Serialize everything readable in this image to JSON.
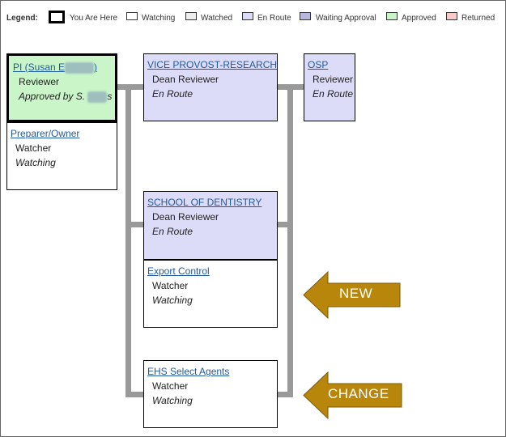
{
  "legend": {
    "title": "Legend:",
    "items": [
      {
        "label": "You Are Here",
        "color": "#ffffff"
      },
      {
        "label": "Watching",
        "color": "#ffffff"
      },
      {
        "label": "Watched",
        "color": "#eeeeee"
      },
      {
        "label": "En Route",
        "color": "#dcdcf8"
      },
      {
        "label": "Waiting Approval",
        "color": "#b8b8de"
      },
      {
        "label": "Approved",
        "color": "#c9f5c9"
      },
      {
        "label": "Returned",
        "color": "#f8caca"
      }
    ]
  },
  "nodes": {
    "pi": {
      "title_prefix": "PI (Susan E",
      "title_suffix": ")",
      "role": "Reviewer",
      "status_prefix": "Approved by S.",
      "status_suffix": "s"
    },
    "preparer": {
      "title": "Preparer/Owner",
      "role": "Watcher",
      "status": "Watching"
    },
    "vice_provost": {
      "title": "VICE PROVOST-RESEARCH",
      "role": "Dean Reviewer",
      "status": "En Route"
    },
    "osp": {
      "title": "OSP",
      "role": "Reviewer",
      "status": "En Route"
    },
    "dentistry": {
      "title": "SCHOOL OF DENTISTRY",
      "role": "Dean Reviewer",
      "status": "En Route"
    },
    "export_control": {
      "title": "Export Control",
      "role": "Watcher",
      "status": "Watching"
    },
    "ehs": {
      "title": "EHS Select Agents",
      "role": "Watcher",
      "status": "Watching"
    }
  },
  "annotations": {
    "new_label": "NEW",
    "change_label": "CHANGE",
    "arrow_color": "#b8860b"
  }
}
